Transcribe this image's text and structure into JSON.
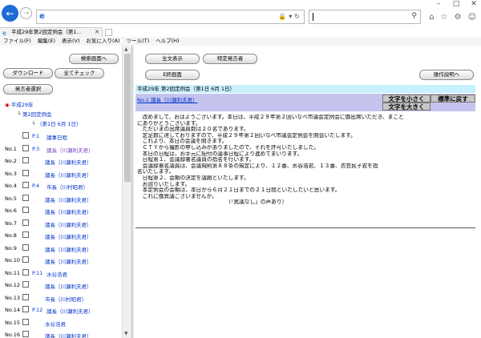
{
  "browser": {
    "tab_title": "平成29年第2回定例会（第1…",
    "menu": [
      "ファイル(F)",
      "編集(E)",
      "表示(V)",
      "お気に入り(A)",
      "ツール(T)",
      "ヘルプ(H)"
    ]
  },
  "left": {
    "buttons": {
      "search_screen": "検索画面へ",
      "download": "ダウンロード",
      "check_all": "全てチェック",
      "speaker_list": "発言者選択"
    },
    "tree": {
      "year": "平成29年",
      "session": "第2回定例会",
      "date": "（第1日 6月 1日）"
    },
    "rows": [
      {
        "no": "",
        "page": "P.1",
        "speaker": "議事日程"
      },
      {
        "no": "No.1",
        "page": "P.3",
        "speaker": "議長（川瀬利夫君）"
      },
      {
        "no": "No.2",
        "page": "",
        "speaker": "議長（川瀬利夫君）"
      },
      {
        "no": "No.3",
        "page": "",
        "speaker": "議長（川瀬利夫君）"
      },
      {
        "no": "No.4",
        "page": "P.4",
        "speaker": "市長（川村昭君）"
      },
      {
        "no": "No.5",
        "page": "",
        "speaker": "議長（川瀬利夫君）"
      },
      {
        "no": "No.6",
        "page": "",
        "speaker": "議長（川瀬利夫君）"
      },
      {
        "no": "No.7",
        "page": "",
        "speaker": "議長（川瀬利夫君）"
      },
      {
        "no": "No.8",
        "page": "",
        "speaker": "議長（川瀬利夫君）"
      },
      {
        "no": "No.9",
        "page": "",
        "speaker": "議長（川瀬利夫君）"
      },
      {
        "no": "No.10",
        "page": "",
        "speaker": "議長（川瀬利夫君）"
      },
      {
        "no": "No.11",
        "page": "P.11",
        "speaker": "水谷浩君"
      },
      {
        "no": "No.12",
        "page": "",
        "speaker": "議長（川瀬利夫君）"
      },
      {
        "no": "No.13",
        "page": "",
        "speaker": "市長（川村昭君）"
      },
      {
        "no": "No.14",
        "page": "P.12",
        "speaker": "議長（川瀬利夫君）"
      },
      {
        "no": "No.15",
        "page": "",
        "speaker": "水谷浩君"
      },
      {
        "no": "No.16",
        "page": "",
        "speaker": "議長（川瀬利夫君）"
      }
    ]
  },
  "right": {
    "buttons": {
      "show_all": "全文表示",
      "specific_speaker": "特定発言者",
      "close_screen": "E終画面",
      "operation_help": "操作説明へ",
      "font_small": "文字を小さく",
      "font_large": "文字を大きく",
      "font_reset": "標準に戻す"
    },
    "header": "平成29年 第2回定例会（第1日 6月 1日）",
    "speaker": "No.1 議長（川瀬利夫君）",
    "speech": [
      "　改めまして、おはようございます。本日は、平成２９年第２回いなべ市議会定例会に御出席いただき、まこと",
      "にありがとうございます。",
      "　ただいまの出席議員数は２０名であります。",
      "　定足数に達しておりますので、平成２９年第２回いなべ市議会定例会を開会いたします。",
      "　これより、本日の会議を開きます。",
      "　ＣＴＹから撮影の申し込みがありましたので、それを許可いたしました。",
      "　本日の日程は、お手元に配付の議事日程により進めてまいります。",
      "　日程第１、会議録署名議員の指名を行います。",
      "　会議録署名議員は、会議規則第８８条の規定により、１２番、水谷浩君、１３番、衣笠民子君を指",
      "名いたします。",
      "　日程第２、会期の決定を議題といたします。",
      "　お諮りいたします。",
      "　本定例会の会期は、本日から６月２１日までの２１日間といたしたいと思います。",
      "　これに御異議ございませんか。",
      "　　　　　　　　　　　　　　　　　（「異議なし」の声あり）"
    ]
  }
}
